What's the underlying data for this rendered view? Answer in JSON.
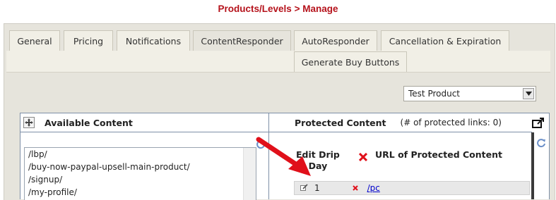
{
  "page": {
    "title": "Products/Levels > Manage"
  },
  "tabs": [
    {
      "label": "General"
    },
    {
      "label": "Pricing"
    },
    {
      "label": "Notifications"
    },
    {
      "label": "ContentResponder",
      "active": true
    },
    {
      "label": "AutoResponder"
    },
    {
      "label": "Cancellation & Expiration"
    },
    {
      "label": "Generate Buy Buttons"
    }
  ],
  "product_select": {
    "value": "Test Product"
  },
  "available": {
    "title": "Available Content",
    "items": [
      "/lbp/",
      "/buy-now-paypal-upsell-main-product/",
      "/signup/",
      "/my-profile/"
    ]
  },
  "protected": {
    "title": "Protected Content",
    "count_text": "(# of protected links: 0)",
    "col_edit_line1": "Edit Drip",
    "col_edit_line2": "Day",
    "col_url": "URL of Protected Content",
    "rows": [
      {
        "day": "1",
        "url": "/pc"
      }
    ]
  },
  "colors": {
    "title": "#b5121b",
    "accent_red": "#e0101a",
    "link": "#0000cc",
    "border": "#7d8fa7"
  },
  "icons": [
    "move-icon",
    "refresh-icon",
    "delete-icon",
    "popout-icon",
    "edit-icon",
    "arrow-icon",
    "dropdown-arrow-icon"
  ]
}
